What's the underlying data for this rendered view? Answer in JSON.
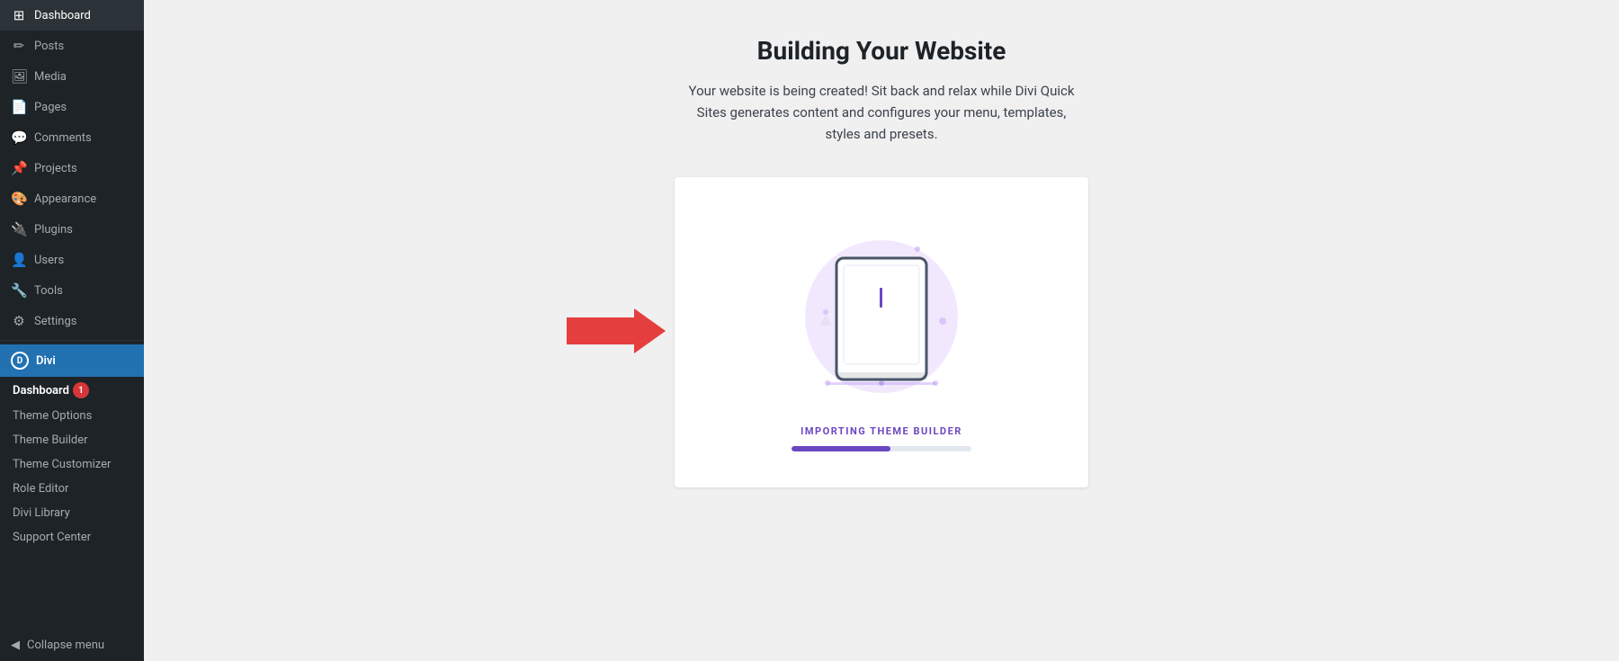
{
  "sidebar": {
    "items": [
      {
        "label": "Dashboard",
        "icon": "⊞",
        "id": "dashboard"
      },
      {
        "label": "Posts",
        "icon": "✎",
        "id": "posts"
      },
      {
        "label": "Media",
        "icon": "⊡",
        "id": "media"
      },
      {
        "label": "Pages",
        "icon": "☰",
        "id": "pages"
      },
      {
        "label": "Comments",
        "icon": "💬",
        "id": "comments"
      },
      {
        "label": "Projects",
        "icon": "📌",
        "id": "projects"
      },
      {
        "label": "Appearance",
        "icon": "🎨",
        "id": "appearance"
      },
      {
        "label": "Plugins",
        "icon": "⊕",
        "id": "plugins"
      },
      {
        "label": "Users",
        "icon": "👤",
        "id": "users"
      },
      {
        "label": "Tools",
        "icon": "🔧",
        "id": "tools"
      },
      {
        "label": "Settings",
        "icon": "⚙",
        "id": "settings"
      }
    ],
    "divi_label": "Divi",
    "divi_sub": [
      {
        "label": "Dashboard",
        "badge": 1,
        "id": "divi-dashboard"
      },
      {
        "label": "Theme Options",
        "id": "theme-options"
      },
      {
        "label": "Theme Builder",
        "id": "theme-builder"
      },
      {
        "label": "Theme Customizer",
        "id": "theme-customizer"
      },
      {
        "label": "Role Editor",
        "id": "role-editor"
      },
      {
        "label": "Divi Library",
        "id": "divi-library"
      },
      {
        "label": "Support Center",
        "id": "support-center"
      }
    ],
    "collapse_label": "Collapse menu"
  },
  "main": {
    "title": "Building Your Website",
    "subtitle": "Your website is being created! Sit back and relax while Divi Quick Sites generates content and configures your menu, templates, styles and presets.",
    "import_status": "IMPORTING THEME BUILDER",
    "progress": 55
  },
  "colors": {
    "accent": "#6b46c1",
    "arrow": "#e53e3e",
    "sidebar_bg": "#1d2327",
    "active_blue": "#2271b1"
  }
}
